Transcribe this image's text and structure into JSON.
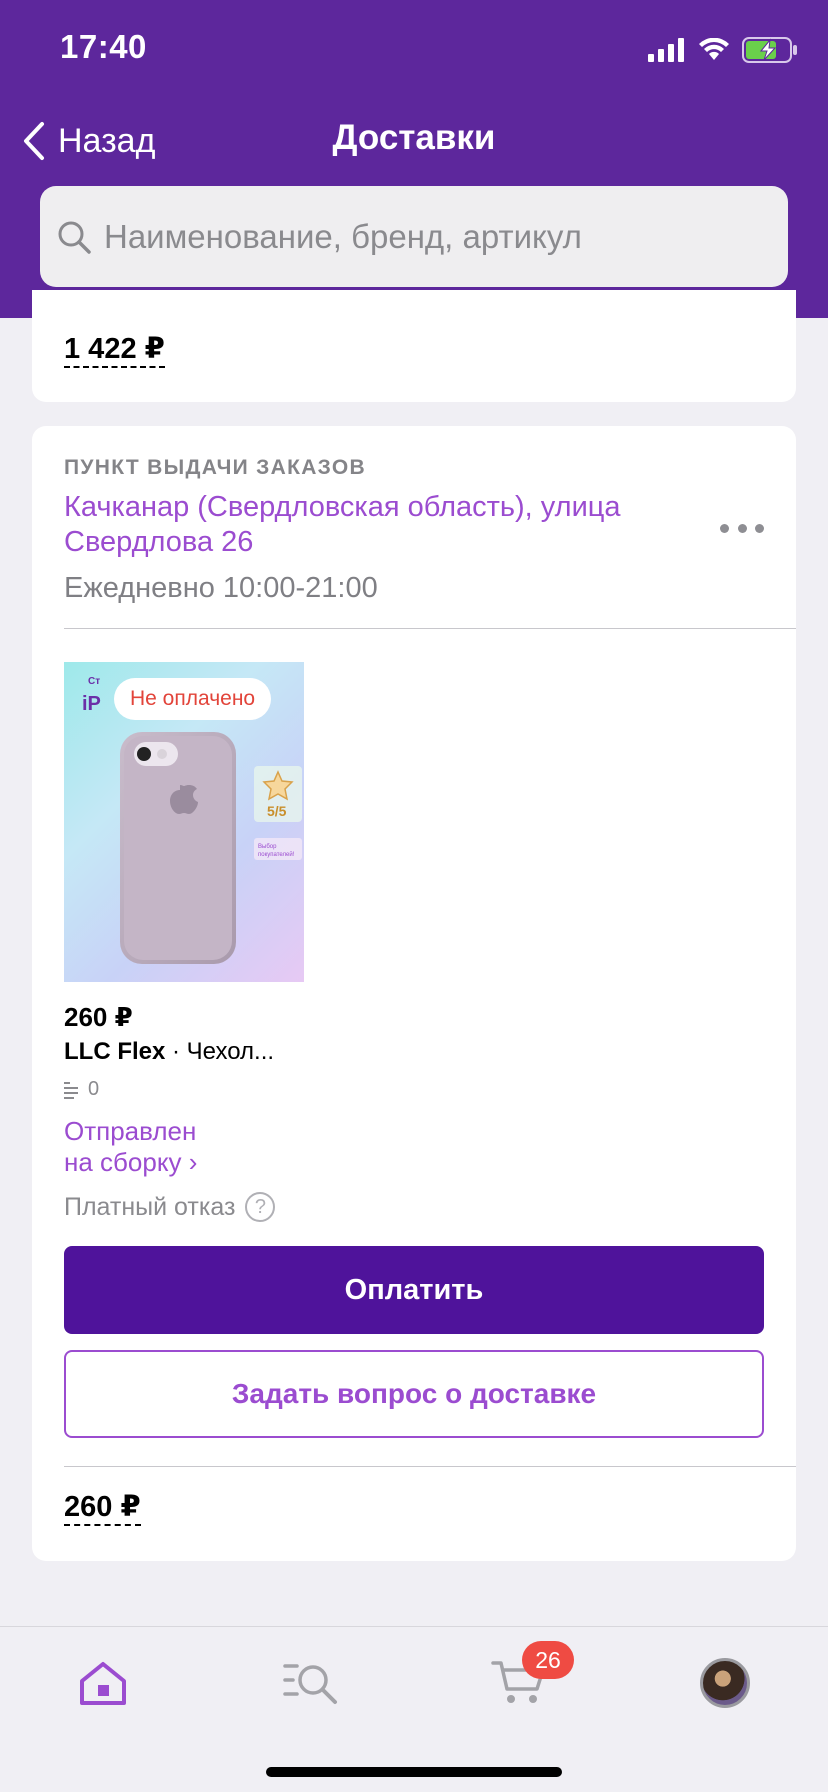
{
  "status_bar": {
    "time": "17:40"
  },
  "nav": {
    "back_label": "Назад",
    "title": "Доставки"
  },
  "search": {
    "placeholder": "Наименование, бренд, артикул"
  },
  "prev_card": {
    "total": "1 422 ₽"
  },
  "delivery": {
    "caption": "ПУНКТ ВЫДАЧИ ЗАКАЗОВ",
    "address": "Качканар (Свердловская область), улица Свердлова 26",
    "hours": "Ежедневно 10:00-21:00",
    "item": {
      "badge": "Не оплачено",
      "price": "260 ₽",
      "brand": "LLC Flex",
      "name": " · Чехол...",
      "qty": "0",
      "status_line1": "Отправлен",
      "status_line2": "на сборку ›",
      "paid_refusal": "Платный отказ",
      "image_texts": {
        "rating": "5/5",
        "tagline": "Выбор покупателей!"
      }
    },
    "pay_button": "Оплатить",
    "ask_button": "Задать вопрос о доставке",
    "total": "260 ₽"
  },
  "tabbar": {
    "cart_count": "26"
  },
  "colors": {
    "header": "#5d279c",
    "accent": "#9b4cd0",
    "pay_button": "#4f139b",
    "badge_red": "#ef4b43"
  }
}
